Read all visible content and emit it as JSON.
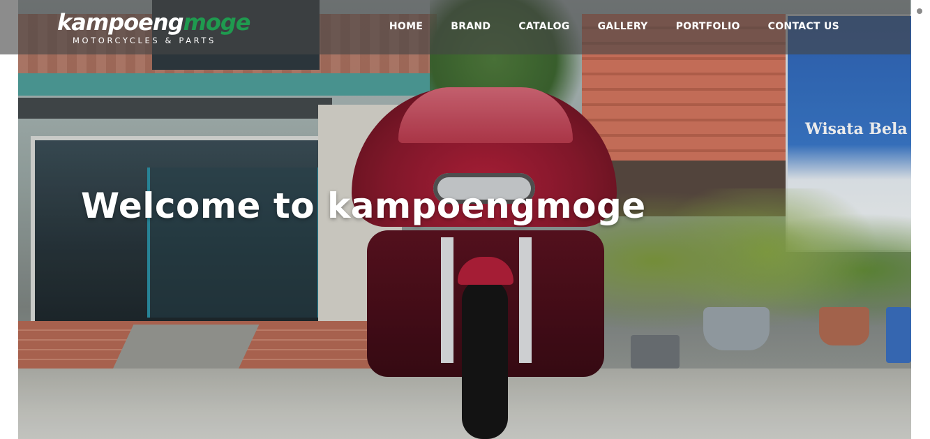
{
  "brand": {
    "logo_primary": "kampoeng",
    "logo_secondary": "moge",
    "tagline": "MOTORCYCLES & PARTS",
    "colors": {
      "logo_green": "#1f9a4f",
      "nav_text": "#ffffff"
    }
  },
  "nav": {
    "items": [
      {
        "label": "HOME"
      },
      {
        "label": "BRAND"
      },
      {
        "label": "CATALOG"
      },
      {
        "label": "GALLERY"
      },
      {
        "label": "PORTFOLIO"
      },
      {
        "label": "CONTACT US"
      }
    ]
  },
  "hero": {
    "headline": "Welcome to kampoengmoge",
    "photo_subject": "red touring motorcycle parked in front of a shop"
  },
  "background_signage": {
    "banner_text": "Wisata Bela"
  }
}
